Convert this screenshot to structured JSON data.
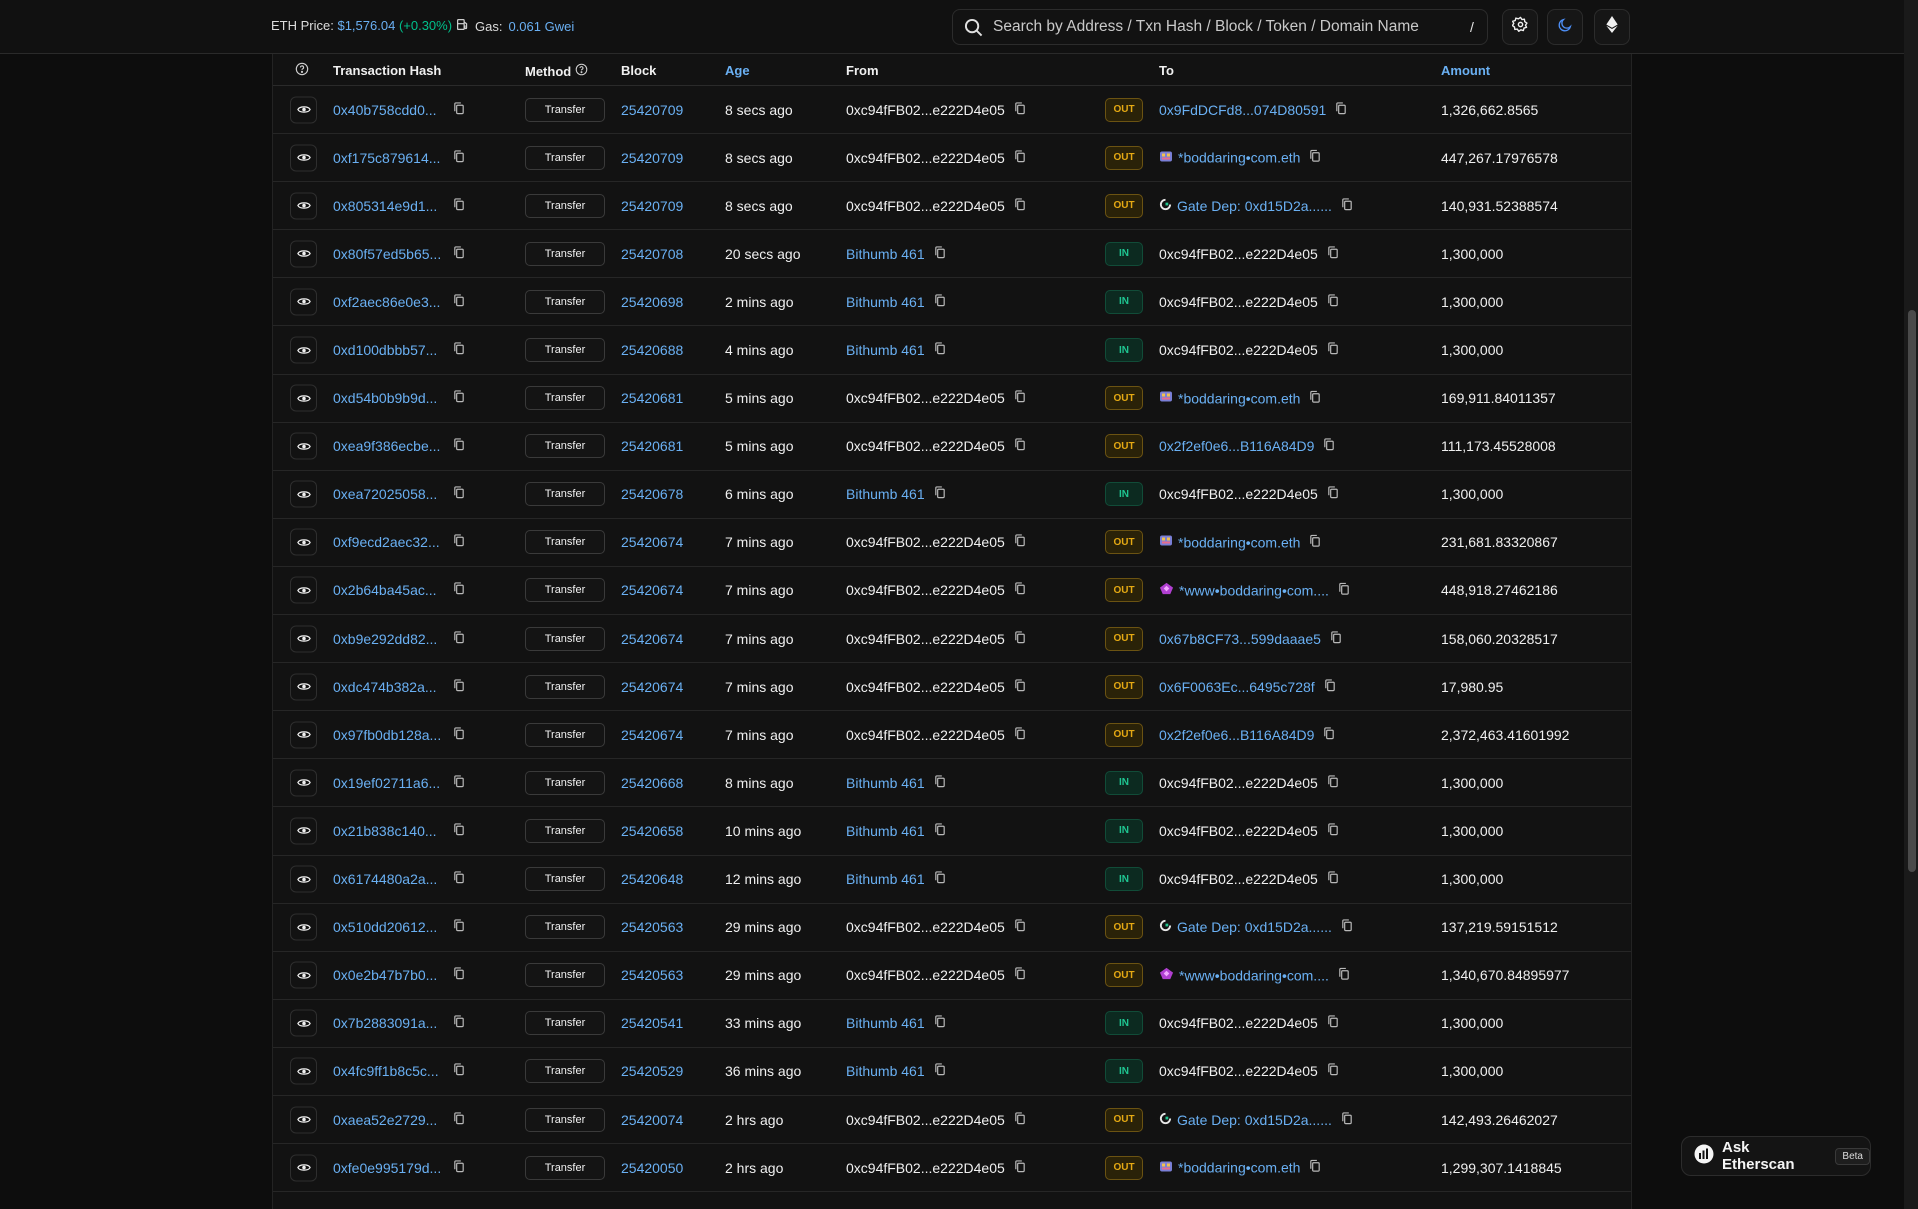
{
  "header": {
    "eth_price_label": "ETH Price:",
    "eth_price_value": "$1,576.04",
    "eth_price_change": "(+0.30%)",
    "gas_label": "Gas:",
    "gas_value": "0.061 Gwei",
    "search_placeholder": "Search by Address / Txn Hash / Block / Token / Domain Name",
    "search_shortcut": "/"
  },
  "table": {
    "columns": {
      "hash": "Transaction Hash",
      "method": "Method",
      "block": "Block",
      "age": "Age",
      "from": "From",
      "to": "To",
      "amount": "Amount"
    },
    "rows": [
      {
        "hash": "0x40b758cdd0...",
        "method": "Transfer",
        "block": "25420709",
        "age": "8 secs ago",
        "from": "0xc94fFB02...e222D4e05",
        "from_link": false,
        "dir": "OUT",
        "to": "0x9FdDCFd8...074D80591",
        "to_link": true,
        "to_icon": "",
        "amount": "1,326,662.8565"
      },
      {
        "hash": "0xf175c879614...",
        "method": "Transfer",
        "block": "25420709",
        "age": "8 secs ago",
        "from": "0xc94fFB02...e222D4e05",
        "from_link": false,
        "dir": "OUT",
        "to": "*boddaring•com.eth",
        "to_link": true,
        "to_icon": "ens",
        "amount": "447,267.17976578"
      },
      {
        "hash": "0x805314e9d1...",
        "method": "Transfer",
        "block": "25420709",
        "age": "8 secs ago",
        "from": "0xc94fFB02...e222D4e05",
        "from_link": false,
        "dir": "OUT",
        "to": "Gate Dep: 0xd15D2a......",
        "to_link": true,
        "to_icon": "gate",
        "amount": "140,931.52388574"
      },
      {
        "hash": "0x80f57ed5b65...",
        "method": "Transfer",
        "block": "25420708",
        "age": "20 secs ago",
        "from": "Bithumb 461",
        "from_link": true,
        "dir": "IN",
        "to": "0xc94fFB02...e222D4e05",
        "to_link": false,
        "to_icon": "",
        "amount": "1,300,000"
      },
      {
        "hash": "0xf2aec86e0e3...",
        "method": "Transfer",
        "block": "25420698",
        "age": "2 mins ago",
        "from": "Bithumb 461",
        "from_link": true,
        "dir": "IN",
        "to": "0xc94fFB02...e222D4e05",
        "to_link": false,
        "to_icon": "",
        "amount": "1,300,000"
      },
      {
        "hash": "0xd100dbbb57...",
        "method": "Transfer",
        "block": "25420688",
        "age": "4 mins ago",
        "from": "Bithumb 461",
        "from_link": true,
        "dir": "IN",
        "to": "0xc94fFB02...e222D4e05",
        "to_link": false,
        "to_icon": "",
        "amount": "1,300,000"
      },
      {
        "hash": "0xd54b0b9b9d...",
        "method": "Transfer",
        "block": "25420681",
        "age": "5 mins ago",
        "from": "0xc94fFB02...e222D4e05",
        "from_link": false,
        "dir": "OUT",
        "to": "*boddaring•com.eth",
        "to_link": true,
        "to_icon": "ens",
        "amount": "169,911.84011357"
      },
      {
        "hash": "0xea9f386ecbe...",
        "method": "Transfer",
        "block": "25420681",
        "age": "5 mins ago",
        "from": "0xc94fFB02...e222D4e05",
        "from_link": false,
        "dir": "OUT",
        "to": "0x2f2ef0e6...B116A84D9",
        "to_link": true,
        "to_icon": "",
        "amount": "111,173.45528008"
      },
      {
        "hash": "0xea72025058...",
        "method": "Transfer",
        "block": "25420678",
        "age": "6 mins ago",
        "from": "Bithumb 461",
        "from_link": true,
        "dir": "IN",
        "to": "0xc94fFB02...e222D4e05",
        "to_link": false,
        "to_icon": "",
        "amount": "1,300,000"
      },
      {
        "hash": "0xf9ecd2aec32...",
        "method": "Transfer",
        "block": "25420674",
        "age": "7 mins ago",
        "from": "0xc94fFB02...e222D4e05",
        "from_link": false,
        "dir": "OUT",
        "to": "*boddaring•com.eth",
        "to_link": true,
        "to_icon": "ens",
        "amount": "231,681.83320867"
      },
      {
        "hash": "0x2b64ba45ac...",
        "method": "Transfer",
        "block": "25420674",
        "age": "7 mins ago",
        "from": "0xc94fFB02...e222D4e05",
        "from_link": false,
        "dir": "OUT",
        "to": "*www•boddaring•com....",
        "to_link": true,
        "to_icon": "gem",
        "amount": "448,918.27462186"
      },
      {
        "hash": "0xb9e292dd82...",
        "method": "Transfer",
        "block": "25420674",
        "age": "7 mins ago",
        "from": "0xc94fFB02...e222D4e05",
        "from_link": false,
        "dir": "OUT",
        "to": "0x67b8CF73...599daaae5",
        "to_link": true,
        "to_icon": "",
        "amount": "158,060.20328517"
      },
      {
        "hash": "0xdc474b382a...",
        "method": "Transfer",
        "block": "25420674",
        "age": "7 mins ago",
        "from": "0xc94fFB02...e222D4e05",
        "from_link": false,
        "dir": "OUT",
        "to": "0x6F0063Ec...6495c728f",
        "to_link": true,
        "to_icon": "",
        "amount": "17,980.95"
      },
      {
        "hash": "0x97fb0db128a...",
        "method": "Transfer",
        "block": "25420674",
        "age": "7 mins ago",
        "from": "0xc94fFB02...e222D4e05",
        "from_link": false,
        "dir": "OUT",
        "to": "0x2f2ef0e6...B116A84D9",
        "to_link": true,
        "to_icon": "",
        "amount": "2,372,463.41601992"
      },
      {
        "hash": "0x19ef02711a6...",
        "method": "Transfer",
        "block": "25420668",
        "age": "8 mins ago",
        "from": "Bithumb 461",
        "from_link": true,
        "dir": "IN",
        "to": "0xc94fFB02...e222D4e05",
        "to_link": false,
        "to_icon": "",
        "amount": "1,300,000"
      },
      {
        "hash": "0x21b838c140...",
        "method": "Transfer",
        "block": "25420658",
        "age": "10 mins ago",
        "from": "Bithumb 461",
        "from_link": true,
        "dir": "IN",
        "to": "0xc94fFB02...e222D4e05",
        "to_link": false,
        "to_icon": "",
        "amount": "1,300,000"
      },
      {
        "hash": "0x6174480a2a...",
        "method": "Transfer",
        "block": "25420648",
        "age": "12 mins ago",
        "from": "Bithumb 461",
        "from_link": true,
        "dir": "IN",
        "to": "0xc94fFB02...e222D4e05",
        "to_link": false,
        "to_icon": "",
        "amount": "1,300,000"
      },
      {
        "hash": "0x510dd20612...",
        "method": "Transfer",
        "block": "25420563",
        "age": "29 mins ago",
        "from": "0xc94fFB02...e222D4e05",
        "from_link": false,
        "dir": "OUT",
        "to": "Gate Dep: 0xd15D2a......",
        "to_link": true,
        "to_icon": "gate",
        "amount": "137,219.59151512"
      },
      {
        "hash": "0x0e2b47b7b0...",
        "method": "Transfer",
        "block": "25420563",
        "age": "29 mins ago",
        "from": "0xc94fFB02...e222D4e05",
        "from_link": false,
        "dir": "OUT",
        "to": "*www•boddaring•com....",
        "to_link": true,
        "to_icon": "gem",
        "amount": "1,340,670.84895977"
      },
      {
        "hash": "0x7b2883091a...",
        "method": "Transfer",
        "block": "25420541",
        "age": "33 mins ago",
        "from": "Bithumb 461",
        "from_link": true,
        "dir": "IN",
        "to": "0xc94fFB02...e222D4e05",
        "to_link": false,
        "to_icon": "",
        "amount": "1,300,000"
      },
      {
        "hash": "0x4fc9ff1b8c5c...",
        "method": "Transfer",
        "block": "25420529",
        "age": "36 mins ago",
        "from": "Bithumb 461",
        "from_link": true,
        "dir": "IN",
        "to": "0xc94fFB02...e222D4e05",
        "to_link": false,
        "to_icon": "",
        "amount": "1,300,000"
      },
      {
        "hash": "0xaea52e2729...",
        "method": "Transfer",
        "block": "25420074",
        "age": "2 hrs ago",
        "from": "0xc94fFB02...e222D4e05",
        "from_link": false,
        "dir": "OUT",
        "to": "Gate Dep: 0xd15D2a......",
        "to_link": true,
        "to_icon": "gate",
        "amount": "142,493.26462027"
      },
      {
        "hash": "0xfe0e995179d...",
        "method": "Transfer",
        "block": "25420050",
        "age": "2 hrs ago",
        "from": "0xc94fFB02...e222D4e05",
        "from_link": false,
        "dir": "OUT",
        "to": "*boddaring•com.eth",
        "to_link": true,
        "to_icon": "ens",
        "amount": "1,299,307.1418845"
      }
    ]
  },
  "ask": {
    "label": "Ask Etherscan",
    "beta": "Beta"
  },
  "colors": {
    "link": "#6ab0f3",
    "out": "#e5a913",
    "in": "#1fc591",
    "background": "#121212"
  }
}
